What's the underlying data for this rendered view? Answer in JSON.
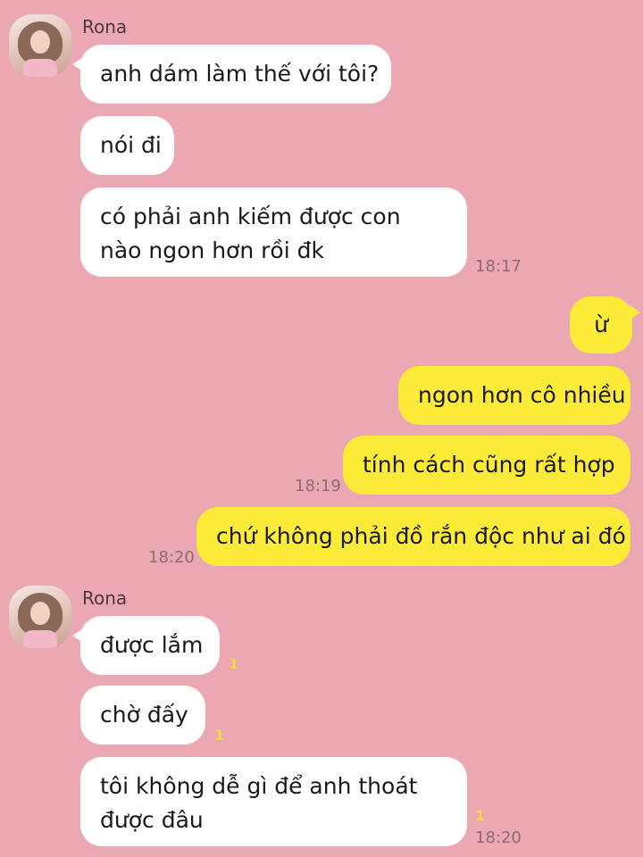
{
  "chat": {
    "group1": {
      "sender": "Rona",
      "messages": [
        "anh dám làm thế với tôi?",
        "nói đi",
        "có phải anh kiếm được con nào ngon hơn rồi đk"
      ],
      "time": "18:17"
    },
    "outgoing": {
      "messages": [
        "ừ",
        "ngon hơn cô nhiều",
        "tính cách cũng rất hợp",
        "chứ không phải đồ rắn độc như ai đó"
      ],
      "time_1": "18:19",
      "time_2": "18:20"
    },
    "group2": {
      "sender": "Rona",
      "messages": [
        "được lắm",
        "chờ đấy",
        "tôi không dễ gì để anh thoát được đâu"
      ],
      "read_1": "1",
      "read_2": "1",
      "read_3": "1",
      "time": "18:20"
    }
  },
  "colors": {
    "background": "#ECA8B2",
    "incoming_bubble": "#FFFFFF",
    "outgoing_bubble": "#FDEB3A"
  },
  "icons": {
    "avatar": "profile-photo"
  }
}
